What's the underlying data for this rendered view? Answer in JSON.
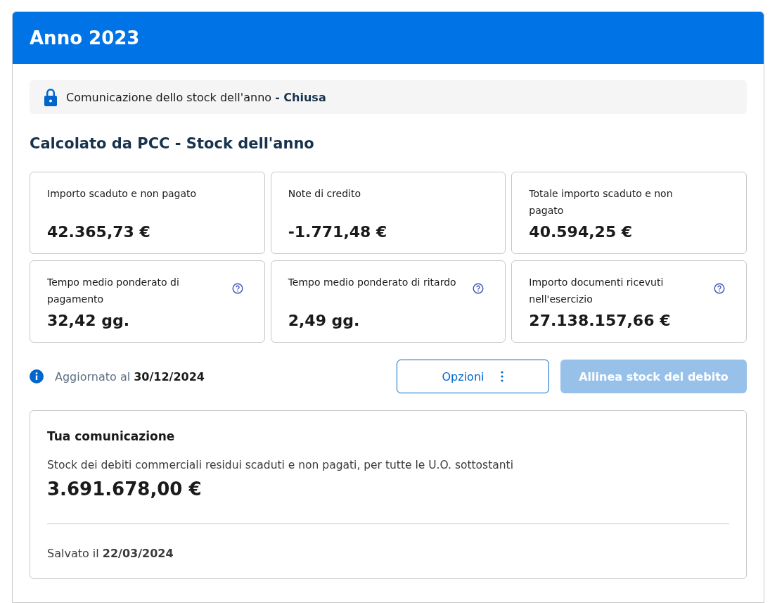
{
  "header": {
    "title": "Anno 2023"
  },
  "status_banner": {
    "text": "Comunicazione dello stock dell'anno **- Chiusa**"
  },
  "section_title": "Calcolato da PCC - Stock dell'anno",
  "tiles": [
    {
      "label": "Importo scaduto e non pagato",
      "value": "42.365,73 €",
      "help": false
    },
    {
      "label": "Note di credito",
      "value": "-1.771,48 €",
      "help": false
    },
    {
      "label": "Totale importo scaduto e non pagato",
      "value": "40.594,25 €",
      "help": false
    },
    {
      "label": "Tempo medio ponderato di pagamento",
      "value": "32,42 gg.",
      "help": true
    },
    {
      "label": "Tempo medio ponderato di ritardo",
      "value": "2,49 gg.",
      "help": true
    },
    {
      "label": "Importo documenti ricevuti nell'esercizio",
      "value": "27.138.157,66 €",
      "help": true
    }
  ],
  "updated": "Aggiornato al **30/12/2024**",
  "buttons": [
    {
      "label": "Opzioni",
      "kind": "outline",
      "disabled": false
    },
    {
      "label": "Allinea stock del debito",
      "kind": "primary",
      "disabled": true
    }
  ],
  "communication": {
    "title": "Tua comunicazione",
    "description": "Stock dei debiti commerciali residui scaduti e non pagati, per tutte le U.O. sottostanti",
    "amount": "3.691.678,00 €",
    "saved": "Salvato il **22/03/2024**"
  }
}
